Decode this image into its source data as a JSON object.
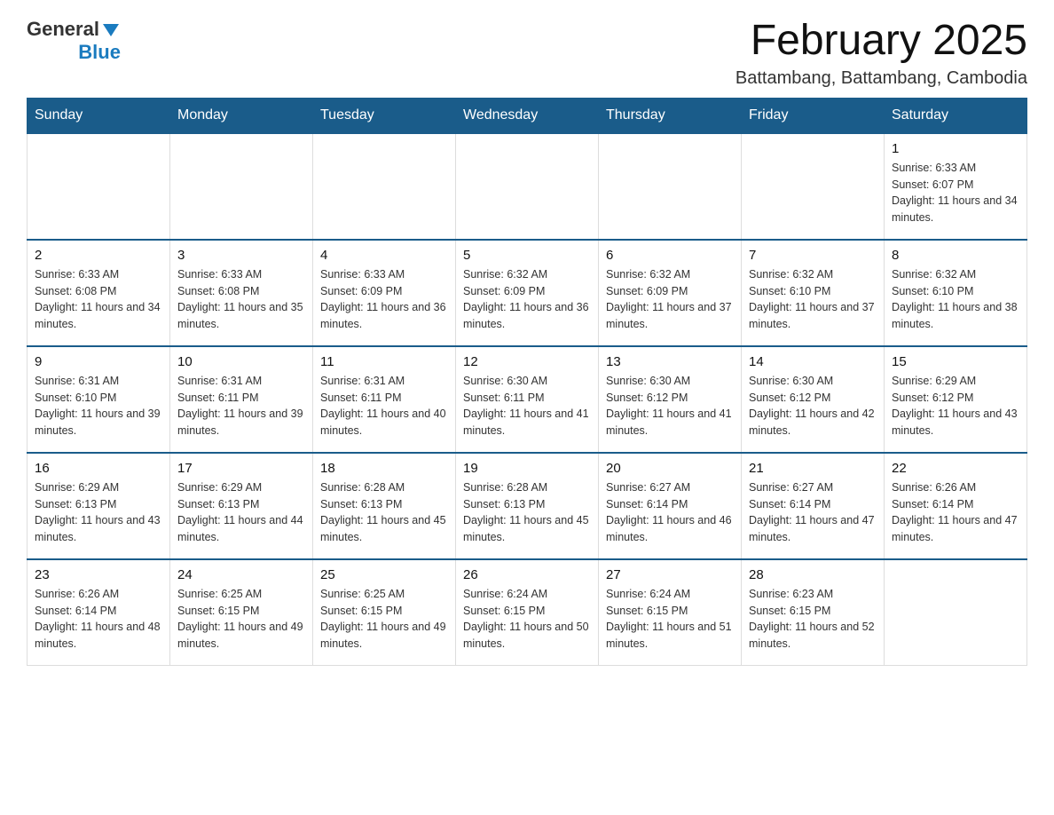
{
  "logo": {
    "general": "General",
    "blue": "Blue"
  },
  "title": "February 2025",
  "subtitle": "Battambang, Battambang, Cambodia",
  "weekdays": [
    "Sunday",
    "Monday",
    "Tuesday",
    "Wednesday",
    "Thursday",
    "Friday",
    "Saturday"
  ],
  "weeks": [
    [
      {
        "day": "",
        "info": ""
      },
      {
        "day": "",
        "info": ""
      },
      {
        "day": "",
        "info": ""
      },
      {
        "day": "",
        "info": ""
      },
      {
        "day": "",
        "info": ""
      },
      {
        "day": "",
        "info": ""
      },
      {
        "day": "1",
        "info": "Sunrise: 6:33 AM\nSunset: 6:07 PM\nDaylight: 11 hours and 34 minutes."
      }
    ],
    [
      {
        "day": "2",
        "info": "Sunrise: 6:33 AM\nSunset: 6:08 PM\nDaylight: 11 hours and 34 minutes."
      },
      {
        "day": "3",
        "info": "Sunrise: 6:33 AM\nSunset: 6:08 PM\nDaylight: 11 hours and 35 minutes."
      },
      {
        "day": "4",
        "info": "Sunrise: 6:33 AM\nSunset: 6:09 PM\nDaylight: 11 hours and 36 minutes."
      },
      {
        "day": "5",
        "info": "Sunrise: 6:32 AM\nSunset: 6:09 PM\nDaylight: 11 hours and 36 minutes."
      },
      {
        "day": "6",
        "info": "Sunrise: 6:32 AM\nSunset: 6:09 PM\nDaylight: 11 hours and 37 minutes."
      },
      {
        "day": "7",
        "info": "Sunrise: 6:32 AM\nSunset: 6:10 PM\nDaylight: 11 hours and 37 minutes."
      },
      {
        "day": "8",
        "info": "Sunrise: 6:32 AM\nSunset: 6:10 PM\nDaylight: 11 hours and 38 minutes."
      }
    ],
    [
      {
        "day": "9",
        "info": "Sunrise: 6:31 AM\nSunset: 6:10 PM\nDaylight: 11 hours and 39 minutes."
      },
      {
        "day": "10",
        "info": "Sunrise: 6:31 AM\nSunset: 6:11 PM\nDaylight: 11 hours and 39 minutes."
      },
      {
        "day": "11",
        "info": "Sunrise: 6:31 AM\nSunset: 6:11 PM\nDaylight: 11 hours and 40 minutes."
      },
      {
        "day": "12",
        "info": "Sunrise: 6:30 AM\nSunset: 6:11 PM\nDaylight: 11 hours and 41 minutes."
      },
      {
        "day": "13",
        "info": "Sunrise: 6:30 AM\nSunset: 6:12 PM\nDaylight: 11 hours and 41 minutes."
      },
      {
        "day": "14",
        "info": "Sunrise: 6:30 AM\nSunset: 6:12 PM\nDaylight: 11 hours and 42 minutes."
      },
      {
        "day": "15",
        "info": "Sunrise: 6:29 AM\nSunset: 6:12 PM\nDaylight: 11 hours and 43 minutes."
      }
    ],
    [
      {
        "day": "16",
        "info": "Sunrise: 6:29 AM\nSunset: 6:13 PM\nDaylight: 11 hours and 43 minutes."
      },
      {
        "day": "17",
        "info": "Sunrise: 6:29 AM\nSunset: 6:13 PM\nDaylight: 11 hours and 44 minutes."
      },
      {
        "day": "18",
        "info": "Sunrise: 6:28 AM\nSunset: 6:13 PM\nDaylight: 11 hours and 45 minutes."
      },
      {
        "day": "19",
        "info": "Sunrise: 6:28 AM\nSunset: 6:13 PM\nDaylight: 11 hours and 45 minutes."
      },
      {
        "day": "20",
        "info": "Sunrise: 6:27 AM\nSunset: 6:14 PM\nDaylight: 11 hours and 46 minutes."
      },
      {
        "day": "21",
        "info": "Sunrise: 6:27 AM\nSunset: 6:14 PM\nDaylight: 11 hours and 47 minutes."
      },
      {
        "day": "22",
        "info": "Sunrise: 6:26 AM\nSunset: 6:14 PM\nDaylight: 11 hours and 47 minutes."
      }
    ],
    [
      {
        "day": "23",
        "info": "Sunrise: 6:26 AM\nSunset: 6:14 PM\nDaylight: 11 hours and 48 minutes."
      },
      {
        "day": "24",
        "info": "Sunrise: 6:25 AM\nSunset: 6:15 PM\nDaylight: 11 hours and 49 minutes."
      },
      {
        "day": "25",
        "info": "Sunrise: 6:25 AM\nSunset: 6:15 PM\nDaylight: 11 hours and 49 minutes."
      },
      {
        "day": "26",
        "info": "Sunrise: 6:24 AM\nSunset: 6:15 PM\nDaylight: 11 hours and 50 minutes."
      },
      {
        "day": "27",
        "info": "Sunrise: 6:24 AM\nSunset: 6:15 PM\nDaylight: 11 hours and 51 minutes."
      },
      {
        "day": "28",
        "info": "Sunrise: 6:23 AM\nSunset: 6:15 PM\nDaylight: 11 hours and 52 minutes."
      },
      {
        "day": "",
        "info": ""
      }
    ]
  ]
}
